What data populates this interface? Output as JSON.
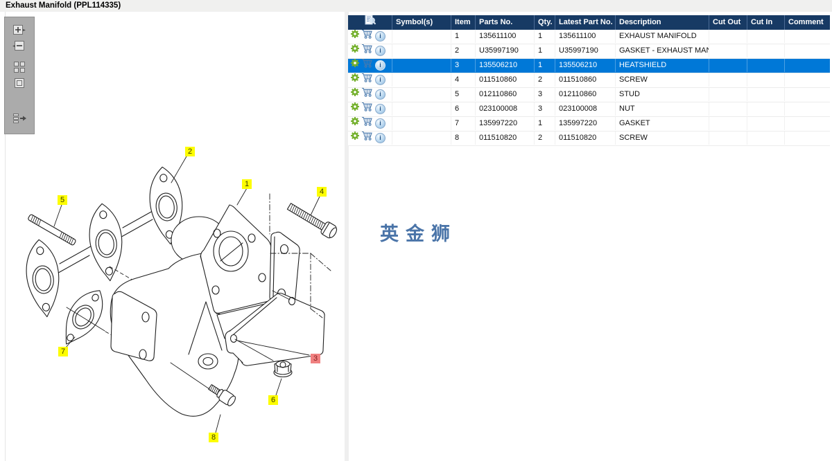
{
  "window": {
    "title": "Exhaust Manifold (PPL114335)"
  },
  "viewer_toolbar": {
    "buttons": [
      {
        "icon": "zoom-in-icon"
      },
      {
        "icon": "zoom-out-icon"
      },
      {
        "icon": "zoom-selection-icon"
      },
      {
        "icon": "fit-page-icon"
      },
      {
        "icon": "toggle-parts-list-icon"
      }
    ]
  },
  "watermark": {
    "text": "英金狮",
    "color": "#4a74a8"
  },
  "diagram": {
    "labels": [
      {
        "text": "1",
        "highlighted": false
      },
      {
        "text": "2",
        "highlighted": false
      },
      {
        "text": "3",
        "highlighted": true
      },
      {
        "text": "4",
        "highlighted": false
      },
      {
        "text": "5",
        "highlighted": false
      },
      {
        "text": "6",
        "highlighted": false
      },
      {
        "text": "7",
        "highlighted": false
      },
      {
        "text": "8",
        "highlighted": false
      }
    ]
  },
  "parts_table": {
    "header_icon": "document-magnifier-icon",
    "row_icons": [
      "gear-icon",
      "cart-icon",
      "info-icon"
    ],
    "info_glyph": "i",
    "columns": [
      {
        "label": "Symbol(s)"
      },
      {
        "label": "Item"
      },
      {
        "label": "Parts No."
      },
      {
        "label": "Qty."
      },
      {
        "label": "Latest Part No."
      },
      {
        "label": "Description"
      },
      {
        "label": "Cut Out"
      },
      {
        "label": "Cut In"
      },
      {
        "label": "Comment"
      }
    ],
    "rows": [
      {
        "symbols": "",
        "item": "1",
        "parts_no": "135611100",
        "qty": "1",
        "latest_part_no": "135611100",
        "description": "EXHAUST MANIFOLD",
        "cut_out": "",
        "cut_in": "",
        "comment": "",
        "selected": false
      },
      {
        "symbols": "",
        "item": "2",
        "parts_no": "U35997190",
        "qty": "1",
        "latest_part_no": "U35997190",
        "description": "GASKET - EXHAUST MANIFOLD",
        "cut_out": "",
        "cut_in": "",
        "comment": "",
        "selected": false
      },
      {
        "symbols": "",
        "item": "3",
        "parts_no": "135506210",
        "qty": "1",
        "latest_part_no": "135506210",
        "description": "HEATSHIELD",
        "cut_out": "",
        "cut_in": "",
        "comment": "",
        "selected": true
      },
      {
        "symbols": "",
        "item": "4",
        "parts_no": "011510860",
        "qty": "2",
        "latest_part_no": "011510860",
        "description": "SCREW",
        "cut_out": "",
        "cut_in": "",
        "comment": "",
        "selected": false
      },
      {
        "symbols": "",
        "item": "5",
        "parts_no": "012110860",
        "qty": "3",
        "latest_part_no": "012110860",
        "description": "STUD",
        "cut_out": "",
        "cut_in": "",
        "comment": "",
        "selected": false
      },
      {
        "symbols": "",
        "item": "6",
        "parts_no": "023100008",
        "qty": "3",
        "latest_part_no": "023100008",
        "description": "NUT",
        "cut_out": "",
        "cut_in": "",
        "comment": "",
        "selected": false
      },
      {
        "symbols": "",
        "item": "7",
        "parts_no": "135997220",
        "qty": "1",
        "latest_part_no": "135997220",
        "description": "GASKET",
        "cut_out": "",
        "cut_in": "",
        "comment": "",
        "selected": false
      },
      {
        "symbols": "",
        "item": "8",
        "parts_no": "011510820",
        "qty": "2",
        "latest_part_no": "011510820",
        "description": "SCREW",
        "cut_out": "",
        "cut_in": "",
        "comment": "",
        "selected": false
      }
    ]
  },
  "colors": {
    "header_bg": "#173a64",
    "selection_bg": "#0078d7",
    "label_bg": "#fdfd00",
    "label_highlight_bg": "#f08080",
    "watermark_blue": "#4a74a8",
    "gear_green": "#74b02c",
    "cart_blue": "#4b7aad"
  }
}
